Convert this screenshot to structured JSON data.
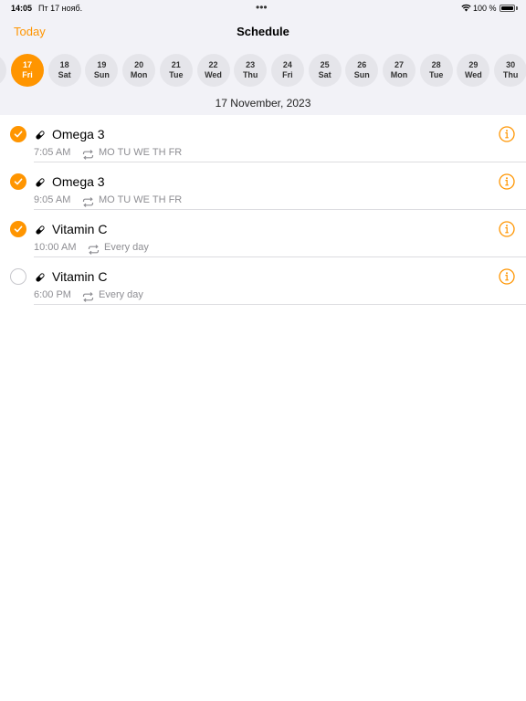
{
  "status_bar": {
    "time": "14:05",
    "date": "Пт 17 нояб.",
    "battery": "100 %"
  },
  "nav": {
    "today_label": "Today",
    "title": "Schedule"
  },
  "days": [
    {
      "num": "17",
      "wd": "Fri",
      "selected": true
    },
    {
      "num": "18",
      "wd": "Sat"
    },
    {
      "num": "19",
      "wd": "Sun"
    },
    {
      "num": "20",
      "wd": "Mon"
    },
    {
      "num": "21",
      "wd": "Tue"
    },
    {
      "num": "22",
      "wd": "Wed"
    },
    {
      "num": "23",
      "wd": "Thu"
    },
    {
      "num": "24",
      "wd": "Fri"
    },
    {
      "num": "25",
      "wd": "Sat"
    },
    {
      "num": "26",
      "wd": "Sun"
    },
    {
      "num": "27",
      "wd": "Mon"
    },
    {
      "num": "28",
      "wd": "Tue"
    },
    {
      "num": "29",
      "wd": "Wed"
    },
    {
      "num": "30",
      "wd": "Thu"
    }
  ],
  "selected_date": "17 November, 2023",
  "items": [
    {
      "name": "Omega 3",
      "time": "7:05 AM",
      "frequency": "MO TU WE TH FR",
      "taken": true
    },
    {
      "name": "Omega 3",
      "time": "9:05 AM",
      "frequency": "MO TU WE TH FR",
      "taken": true
    },
    {
      "name": "Vitamin C",
      "time": "10:00 AM",
      "frequency": "Every day",
      "taken": true
    },
    {
      "name": "Vitamin C",
      "time": "6:00 PM",
      "frequency": "Every day",
      "taken": false
    }
  ],
  "colors": {
    "accent": "#ff9500",
    "secondary_text": "#8e8e93",
    "background_top": "#f2f2f7"
  },
  "icons": {
    "item": "pill-icon",
    "repeat": "repeat-icon",
    "info": "info-icon",
    "check": "checkmark-icon"
  }
}
